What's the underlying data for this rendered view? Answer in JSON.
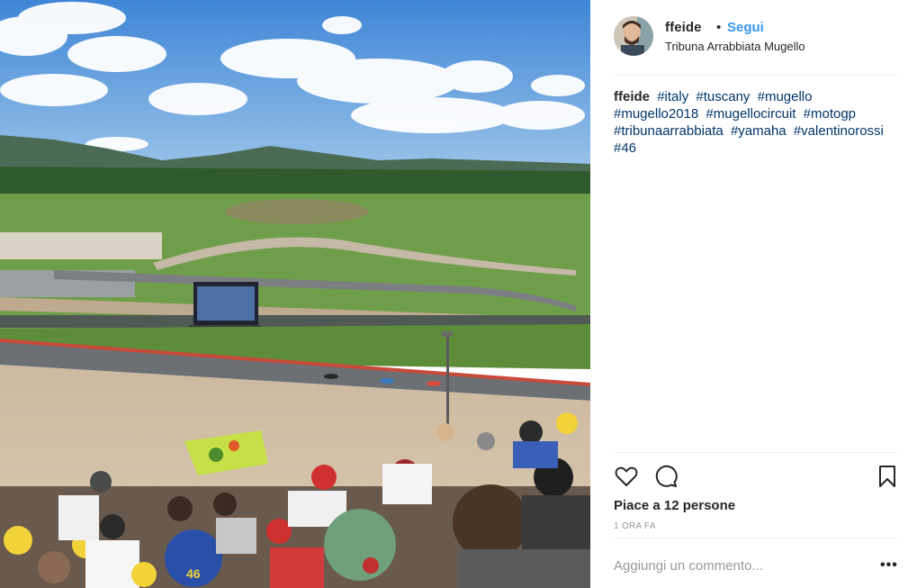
{
  "post": {
    "image_alt": "Tribuna Arrabbiata, Mugello circuit, crowd watching MotoGP race",
    "header": {
      "username": "ffeide",
      "separator": "•",
      "follow_label": "Segui",
      "location": "Tribuna Arrabbiata Mugello"
    },
    "caption": {
      "username": "ffeide",
      "hashtags": [
        "#italy",
        "#tuscany",
        "#mugello",
        "#mugello2018",
        "#mugellocircuit",
        "#motogp",
        "#tribunaarrabbiata",
        "#yamaha",
        "#valentinorossi",
        "#46"
      ]
    },
    "actions": {
      "like_icon": "heart-icon",
      "comment_icon": "comment-icon",
      "save_icon": "bookmark-icon"
    },
    "likes_text": "Piace a 12 persone",
    "timestamp": "1 ORA FA",
    "comment": {
      "placeholder": "Aggiungi un commento...",
      "value": "",
      "more_label": "•••"
    }
  },
  "colors": {
    "link_blue": "#3897f0",
    "hashtag_blue": "#003569",
    "muted_gray": "#999999",
    "divider": "#efefef"
  }
}
